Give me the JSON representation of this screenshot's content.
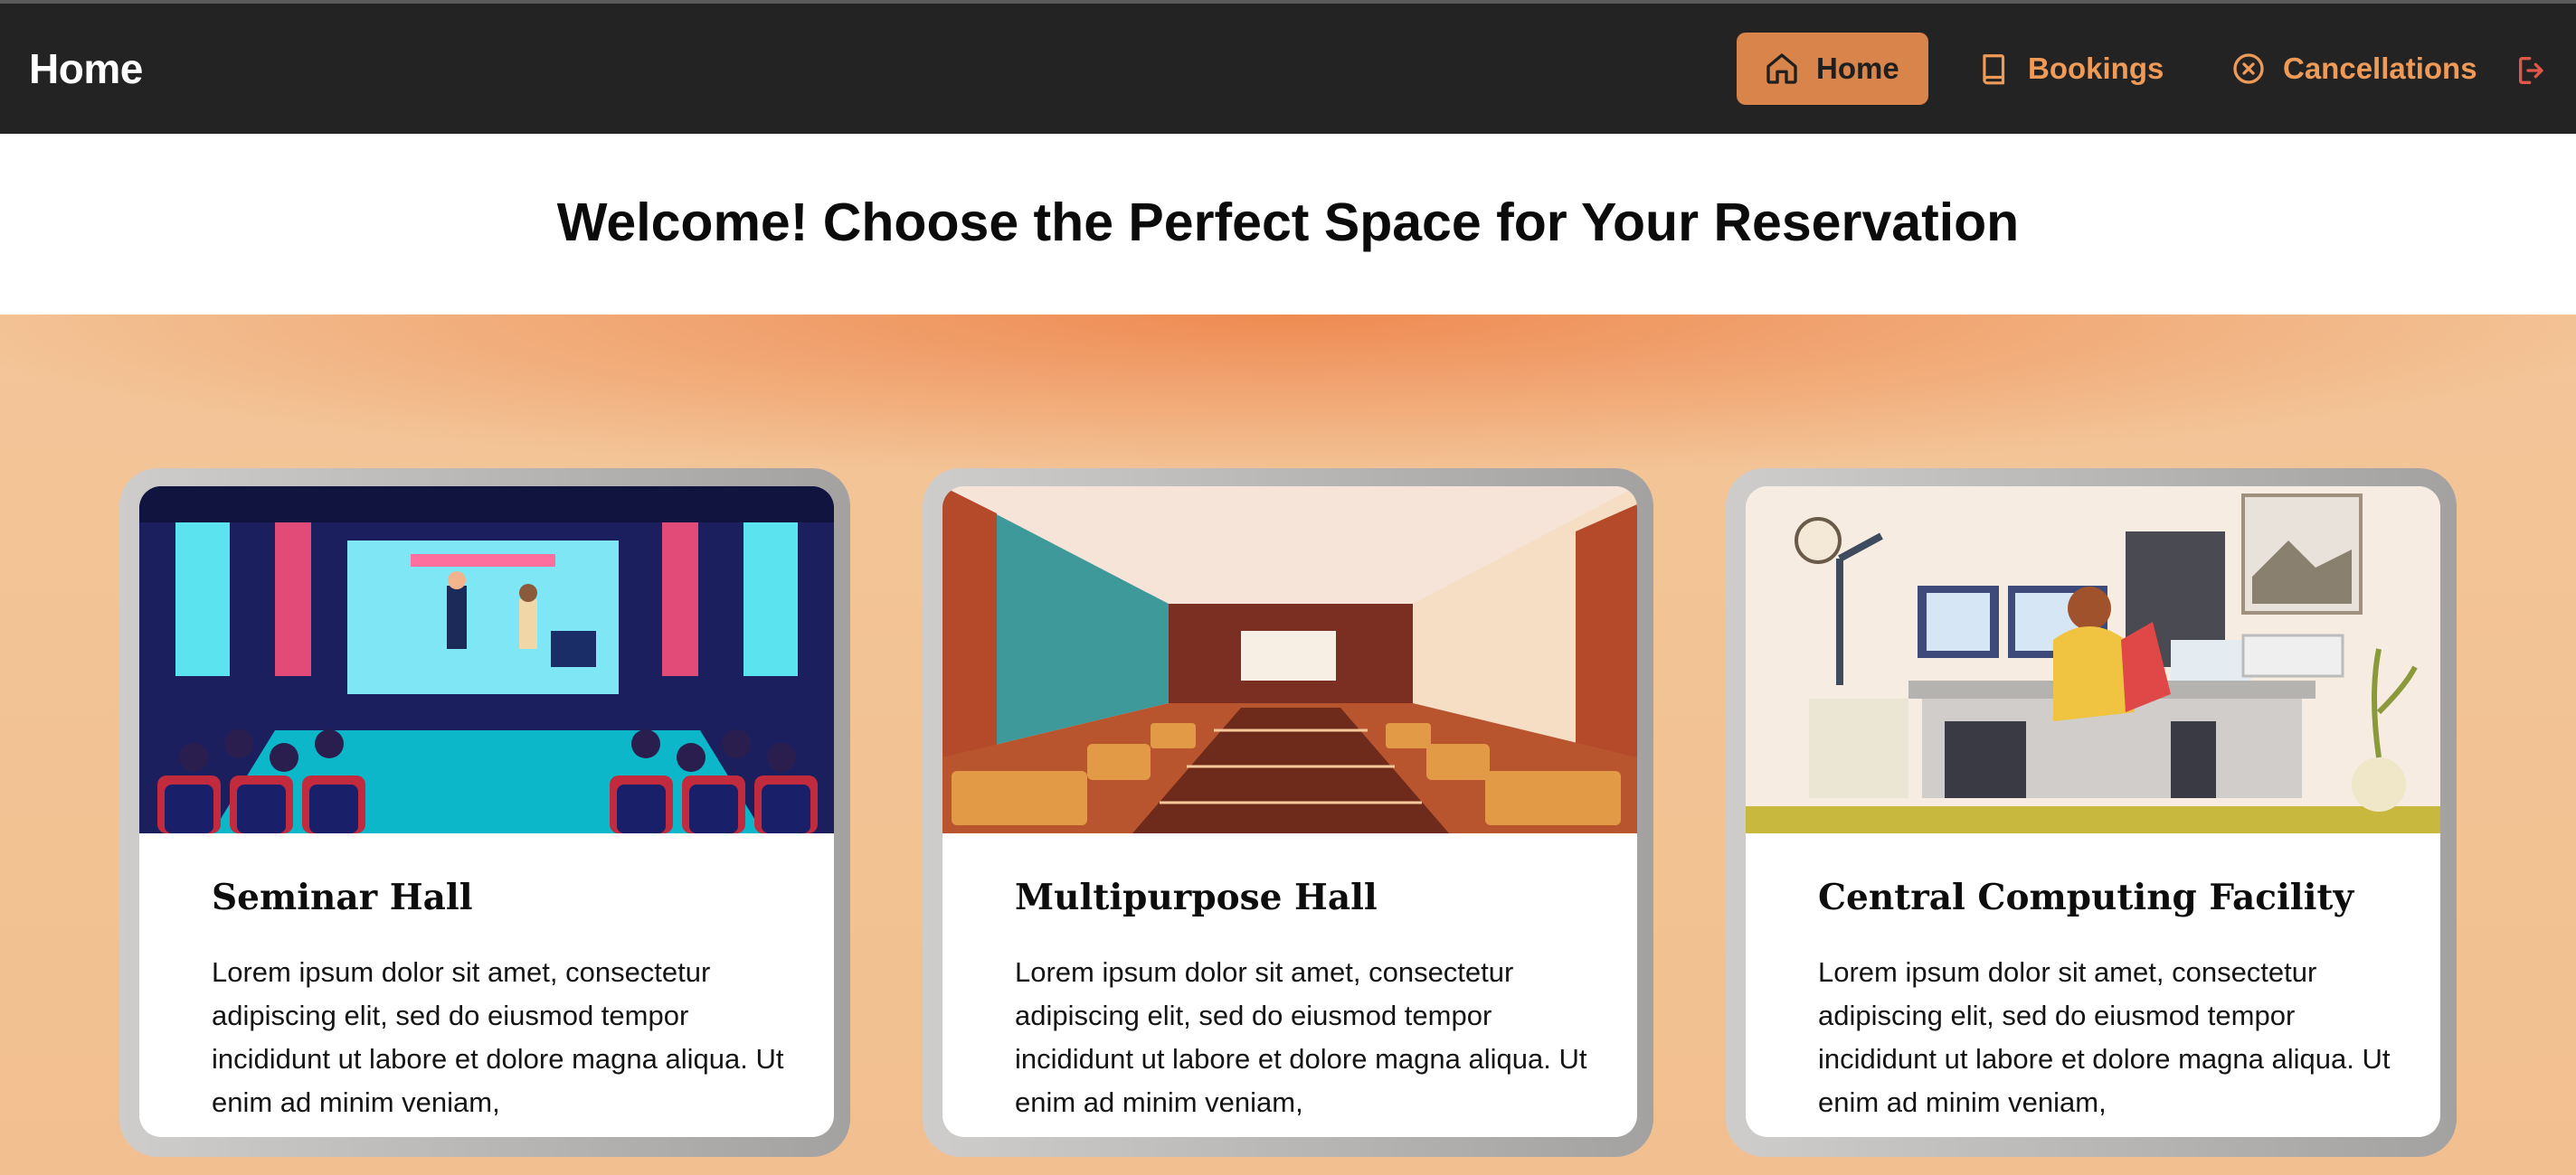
{
  "nav": {
    "brand": "Home",
    "items": [
      {
        "label": "Home",
        "icon": "home-icon",
        "active": true
      },
      {
        "label": "Bookings",
        "icon": "book-icon",
        "active": false
      },
      {
        "label": "Cancellations",
        "icon": "x-circle-icon",
        "active": false
      }
    ],
    "logout_icon": "logout-icon"
  },
  "main": {
    "title": "Welcome! Choose the Perfect Space for Your Reservation",
    "cards": [
      {
        "title": "Seminar Hall",
        "image": "seminar-hall-illustration",
        "description": "Lorem ipsum dolor sit amet, consectetur adipiscing elit, sed do eiusmod tempor incididunt ut labore et dolore magna aliqua. Ut enim ad minim veniam,"
      },
      {
        "title": "Multipurpose Hall",
        "image": "multipurpose-hall-illustration",
        "description": "Lorem ipsum dolor sit amet, consectetur adipiscing elit, sed do eiusmod tempor incididunt ut labore et dolore magna aliqua. Ut enim ad minim veniam,"
      },
      {
        "title": "Central Computing Facility",
        "image": "computing-facility-illustration",
        "description": "Lorem ipsum dolor sit amet, consectetur adipiscing elit, sed do eiusmod tempor incididunt ut labore et dolore magna aliqua. Ut enim ad minim veniam,"
      }
    ]
  },
  "colors": {
    "navbar": "#232323",
    "accent": "#d9844b",
    "nav_text": "#ef9a56",
    "background": "#f2c393"
  }
}
